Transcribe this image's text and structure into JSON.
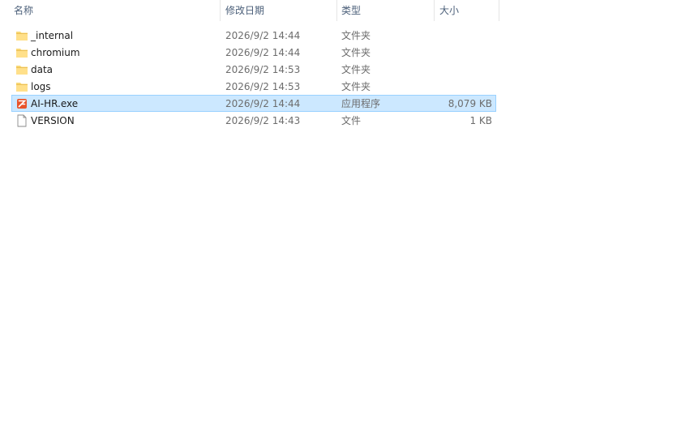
{
  "header": {
    "columns": {
      "name": "名称",
      "date": "修改日期",
      "type": "类型",
      "size": "大小"
    },
    "sort_indicator": "^"
  },
  "files": [
    {
      "name": "_internal",
      "date": "2026/9/2 14:44",
      "type": "文件夹",
      "size": "",
      "icon": "folder-icon"
    },
    {
      "name": "chromium",
      "date": "2026/9/2 14:44",
      "type": "文件夹",
      "size": "",
      "icon": "folder-icon"
    },
    {
      "name": "data",
      "date": "2026/9/2 14:53",
      "type": "文件夹",
      "size": "",
      "icon": "folder-icon"
    },
    {
      "name": "logs",
      "date": "2026/9/2 14:53",
      "type": "文件夹",
      "size": "",
      "icon": "folder-icon"
    },
    {
      "name": "AI-HR.exe",
      "date": "2026/9/2 14:44",
      "type": "应用程序",
      "size": "8,079 KB",
      "icon": "app-icon",
      "selected": true
    },
    {
      "name": "VERSION",
      "date": "2026/9/2 14:43",
      "type": "文件",
      "size": "1 KB",
      "icon": "file-icon"
    }
  ],
  "colors": {
    "selection_bg": "#cce8ff",
    "selection_border": "#99d1ff",
    "header_text": "#4c607a",
    "folder_yellow": "#ffd966",
    "app_orange": "#e8542a"
  }
}
